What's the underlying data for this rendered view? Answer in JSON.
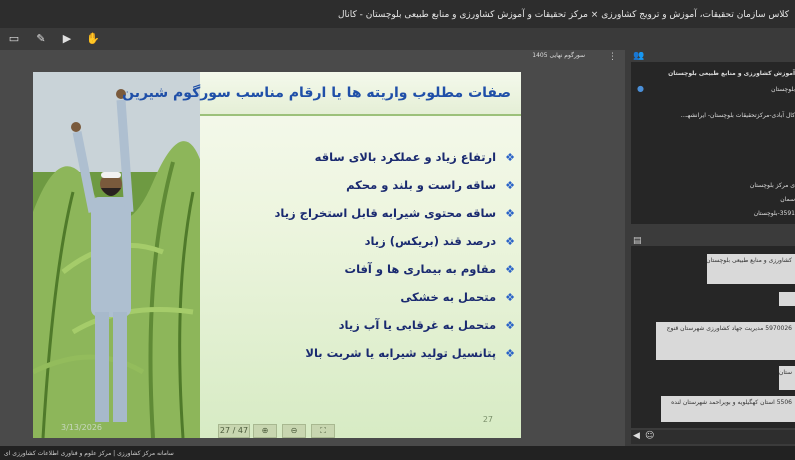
{
  "window": {
    "title": "کلاس سازمان تحقیقات، آموزش و ترویج کشاورزی × مرکز تحقیقات و آموزش کشاورزی و منابع طبیعی بلوچستان - کانال"
  },
  "toolbar": {
    "icons": [
      "laptop-icon",
      "pen-icon",
      "play-icon",
      "hand-icon"
    ]
  },
  "presentation": {
    "file_name": "سورگوم نهایی 1405",
    "photo_date": "3/13/2026",
    "slide_title": "صفات مطلوب واریته ها یا ارقام مناسب سورگوم شیرین",
    "bullets": [
      "ارتفاع زیاد و عملکرد بالای ساقه",
      "ساقه راست و بلند و محکم",
      "ساقه محتوی شیرابه قابل استخراج زیاد",
      "درصد قند (بریکس) زیاد",
      "مقاوم به بیماری ها و آفات",
      "متحمل به خشکی",
      "متحمل به غرقابی یا آب زیاد",
      "پتانسیل تولید شیرابه یا شربت بالا"
    ],
    "slide_number": "27",
    "page_counter": "27 / 47"
  },
  "participants_panel": {
    "lines": [
      "آموزش کشاورزی و منابع طبیعی بلوچستان",
      "بلوچستان",
      "کال آبادی-مرکزتحقیقات بلوچستان- ایرانشهـ...",
      "ی مرکز بلوچستان",
      "سمان",
      "3591-بلوچستان"
    ]
  },
  "chat_panel": {
    "messages": [
      "کشاورزی و منابع طبیعی بلوچستان",
      "5970026 مدیریت جهاد کشاورزی شهرستان قنوج",
      "ستان",
      "5506 استان کهگیلویه و بویراحمد شهرستان لنده"
    ]
  },
  "status_bar": {
    "text": "سامانه مرکز کشاورزی | مرکز علوم و فناوری اطلاعات کشاورزی ای"
  },
  "colors": {
    "accent": "#1f4fa8",
    "bullet_text": "#1a2a70",
    "bullet_mark": "#2a63c8"
  }
}
